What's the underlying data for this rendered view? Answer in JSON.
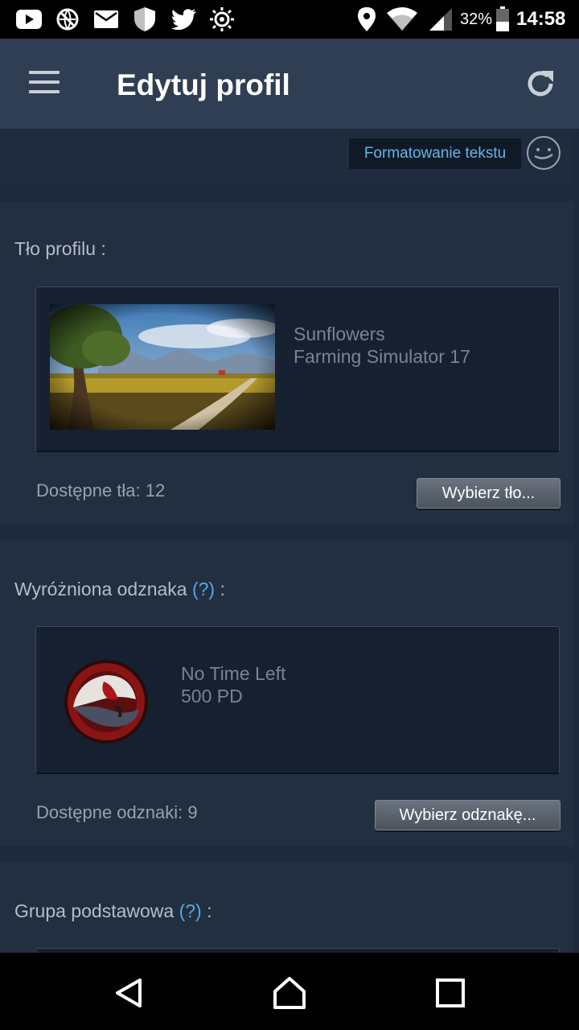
{
  "status_bar": {
    "icons": [
      "youtube-icon",
      "vpn-icon",
      "mail-icon",
      "shield-icon",
      "twitter-icon",
      "brightness-icon",
      "location-icon",
      "wifi-icon",
      "signal-icon",
      "battery-icon"
    ],
    "battery": "32%",
    "time": "14:58"
  },
  "app_bar": {
    "title": "Edytuj profil",
    "icons": [
      "menu-icon",
      "refresh-icon"
    ]
  },
  "formatting": {
    "button_label": "Formatowanie tekstu",
    "icon": "smiley-icon"
  },
  "background_section": {
    "label": "Tło profilu :",
    "item_name": "Sunflowers",
    "item_game": "Farming Simulator 17",
    "available": "Dostępne tła: 12",
    "choose_label": "Wybierz tło..."
  },
  "badge_section": {
    "label": "Wyróżniona odznaka",
    "help": "(?)",
    "suffix": ":",
    "item_name": "No Time Left",
    "item_xp": "500 PD",
    "available": "Dostępne odznaki: 9",
    "choose_label": "Wybierz odznakę..."
  },
  "group_section": {
    "label": "Grupa podstawowa",
    "help": "(?)",
    "suffix": ":"
  },
  "nav_bar": {
    "icons": [
      "back-icon",
      "home-icon",
      "recents-icon"
    ]
  },
  "colors": {
    "background": "#1b2838",
    "app_bar": "#2f3e52",
    "link": "#66b3e8"
  }
}
